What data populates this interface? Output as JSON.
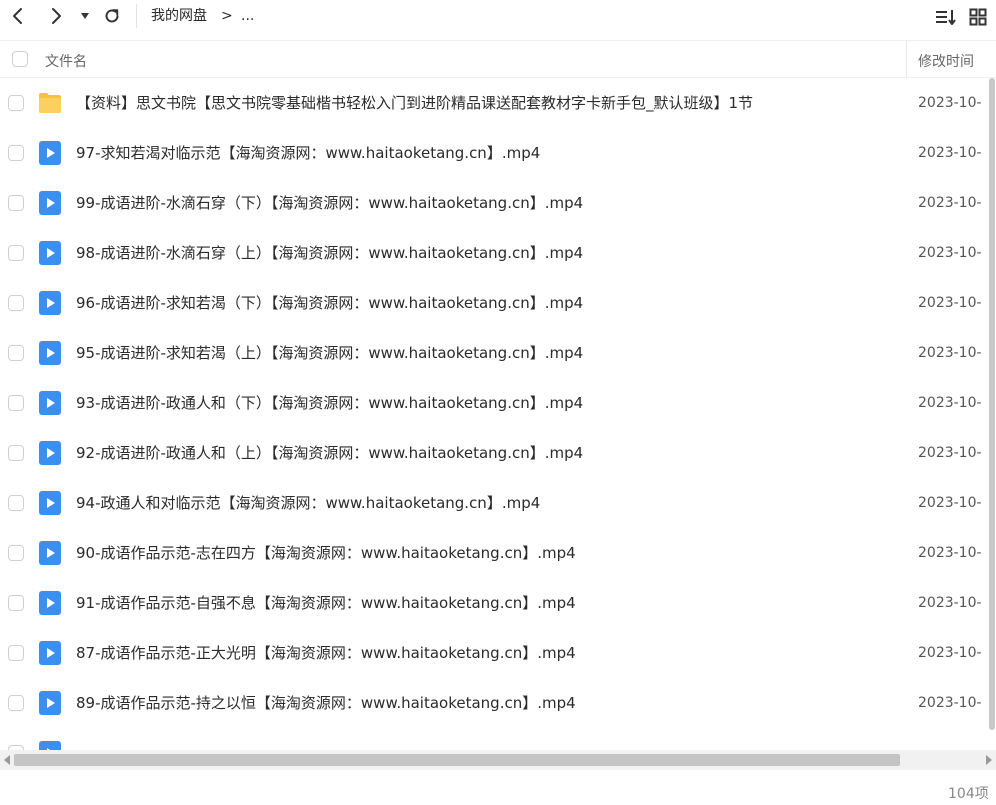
{
  "toolbar": {
    "breadcrumb_root": "我的网盘",
    "breadcrumb_sep": ">",
    "breadcrumb_more": "..."
  },
  "columns": {
    "name": "文件名",
    "modified": "修改时间"
  },
  "files": [
    {
      "type": "folder",
      "icon": "folder-icon",
      "name": "【资料】思文书院【思文书院零基础楷书轻松入门到进阶精品课送配套教材字卡新手包_默认班级】1节",
      "date": "2023-10-"
    },
    {
      "type": "video",
      "icon": "video-file-icon",
      "name": "97-求知若渴对临示范【海淘资源网：www.haitaoketang.cn】.mp4",
      "date": "2023-10-"
    },
    {
      "type": "video",
      "icon": "video-file-icon",
      "name": "99-成语进阶-水滴石穿（下）【海淘资源网：www.haitaoketang.cn】.mp4",
      "date": "2023-10-"
    },
    {
      "type": "video",
      "icon": "video-file-icon",
      "name": "98-成语进阶-水滴石穿（上）【海淘资源网：www.haitaoketang.cn】.mp4",
      "date": "2023-10-"
    },
    {
      "type": "video",
      "icon": "video-file-icon",
      "name": "96-成语进阶-求知若渴（下）【海淘资源网：www.haitaoketang.cn】.mp4",
      "date": "2023-10-"
    },
    {
      "type": "video",
      "icon": "video-file-icon",
      "name": "95-成语进阶-求知若渴（上）【海淘资源网：www.haitaoketang.cn】.mp4",
      "date": "2023-10-"
    },
    {
      "type": "video",
      "icon": "video-file-icon",
      "name": "93-成语进阶-政通人和（下）【海淘资源网：www.haitaoketang.cn】.mp4",
      "date": "2023-10-"
    },
    {
      "type": "video",
      "icon": "video-file-icon",
      "name": "92-成语进阶-政通人和（上）【海淘资源网：www.haitaoketang.cn】.mp4",
      "date": "2023-10-"
    },
    {
      "type": "video",
      "icon": "video-file-icon",
      "name": "94-政通人和对临示范【海淘资源网：www.haitaoketang.cn】.mp4",
      "date": "2023-10-"
    },
    {
      "type": "video",
      "icon": "video-file-icon",
      "name": "90-成语作品示范-志在四方【海淘资源网：www.haitaoketang.cn】.mp4",
      "date": "2023-10-"
    },
    {
      "type": "video",
      "icon": "video-file-icon",
      "name": "91-成语作品示范-自强不息【海淘资源网：www.haitaoketang.cn】.mp4",
      "date": "2023-10-"
    },
    {
      "type": "video",
      "icon": "video-file-icon",
      "name": "87-成语作品示范-正大光明【海淘资源网：www.haitaoketang.cn】.mp4",
      "date": "2023-10-"
    },
    {
      "type": "video",
      "icon": "video-file-icon",
      "name": "89-成语作品示范-持之以恒【海淘资源网：www.haitaoketang.cn】.mp4",
      "date": "2023-10-"
    },
    {
      "type": "video",
      "icon": "video-file-icon",
      "name": "",
      "date": ""
    }
  ],
  "footer": {
    "count": "104项"
  },
  "colors": {
    "folder": "#f7c244",
    "video": "#3b8ff0",
    "text": "#2b2b2b",
    "muted": "#888888"
  }
}
